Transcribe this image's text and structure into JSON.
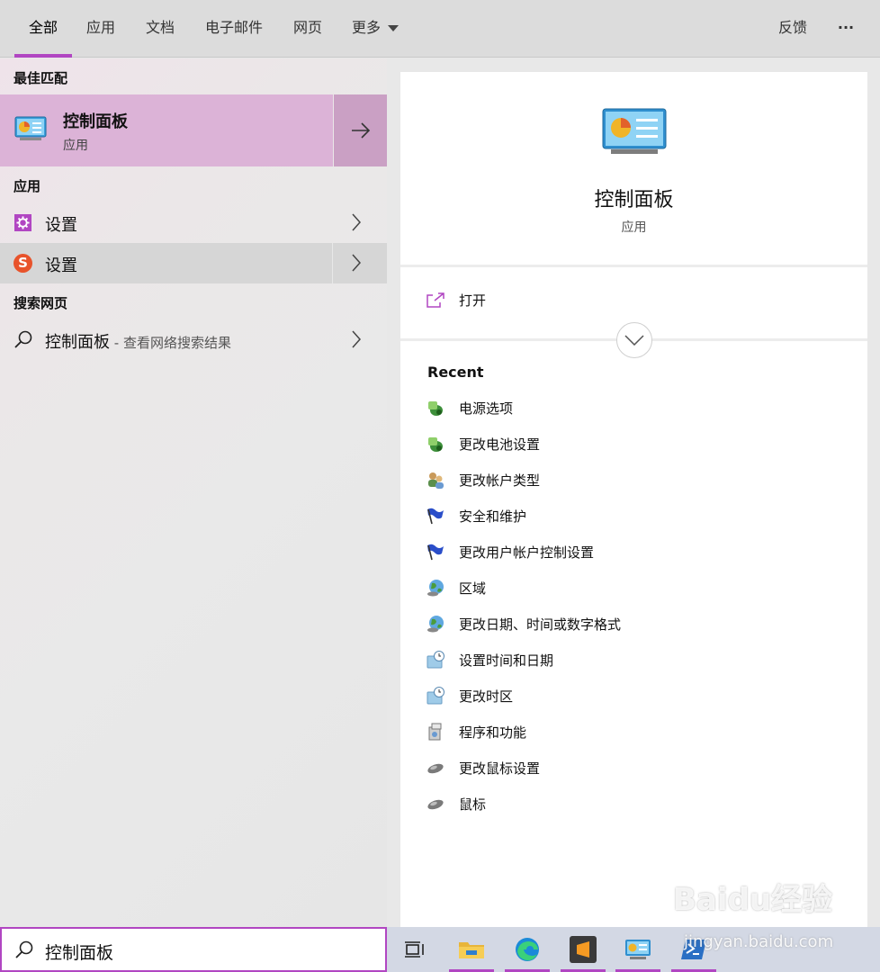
{
  "tabs": [
    {
      "label": "全部",
      "active": true
    },
    {
      "label": "应用"
    },
    {
      "label": "文档"
    },
    {
      "label": "电子邮件"
    },
    {
      "label": "网页"
    },
    {
      "label": "更多"
    }
  ],
  "toolbar": {
    "feedback": "反馈",
    "more": "···"
  },
  "left": {
    "best_match_heading": "最佳匹配",
    "best_match": {
      "title": "控制面板",
      "subtitle": "应用",
      "icon": "control-panel-icon"
    },
    "apps_heading": "应用",
    "apps": [
      {
        "label": "设置",
        "icon": "gear-icon"
      },
      {
        "label": "设置",
        "icon": "sogou-icon"
      }
    ],
    "web_heading": "搜索网页",
    "web": {
      "query": "控制面板",
      "hint": " - 查看网络搜索结果",
      "icon": "search-icon"
    }
  },
  "right": {
    "title": "控制面板",
    "subtitle": "应用",
    "open_label": "打开",
    "recent_heading": "Recent",
    "recent": [
      {
        "label": "电源选项",
        "icon": "power-options-icon"
      },
      {
        "label": "更改电池设置",
        "icon": "power-options-icon"
      },
      {
        "label": "更改帐户类型",
        "icon": "user-accounts-icon"
      },
      {
        "label": "安全和维护",
        "icon": "security-flag-icon"
      },
      {
        "label": "更改用户帐户控制设置",
        "icon": "security-flag-icon"
      },
      {
        "label": "区域",
        "icon": "globe-icon"
      },
      {
        "label": "更改日期、时间或数字格式",
        "icon": "globe-icon"
      },
      {
        "label": "设置时间和日期",
        "icon": "date-time-icon"
      },
      {
        "label": "更改时区",
        "icon": "date-time-icon"
      },
      {
        "label": "程序和功能",
        "icon": "programs-icon"
      },
      {
        "label": "更改鼠标设置",
        "icon": "mouse-icon"
      },
      {
        "label": "鼠标",
        "icon": "mouse-icon"
      }
    ]
  },
  "search": {
    "value": "控制面板"
  },
  "taskbar": {
    "apps": [
      "task-view-icon",
      "file-explorer-icon",
      "edge-icon",
      "sublime-icon",
      "control-panel-icon",
      "powershell-icon"
    ]
  },
  "watermark": {
    "brand": "Baidu经验",
    "url": "jingyan.baidu.com"
  },
  "colors": {
    "accent": "#b146c2",
    "best_match_bg": "#dcb3d7",
    "taskbar_bg": "#d3d8e4"
  }
}
